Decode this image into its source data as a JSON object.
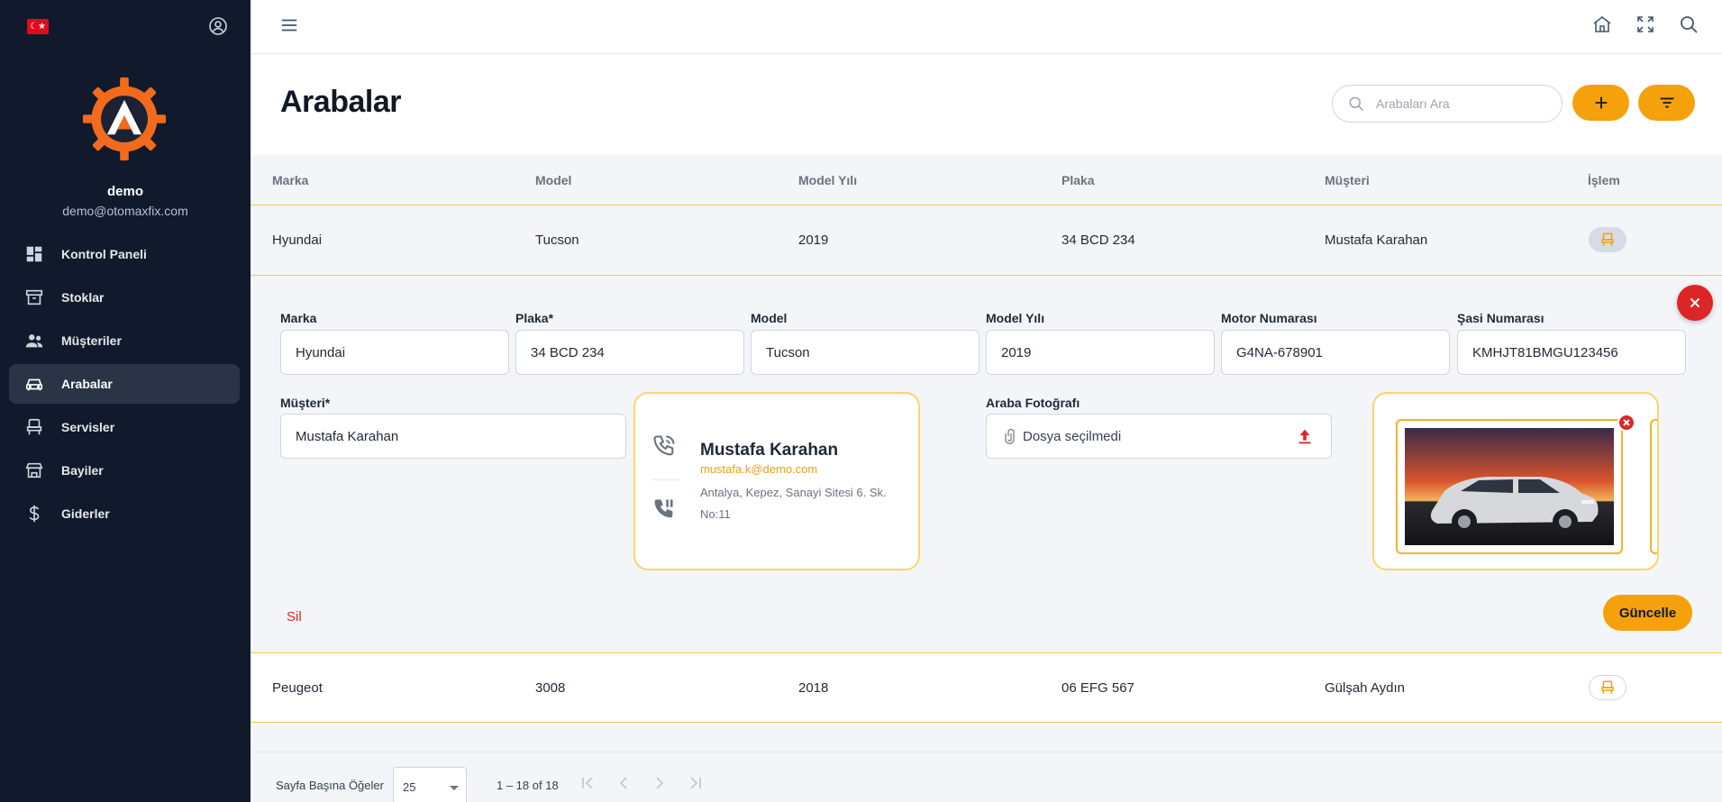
{
  "sidebar": {
    "flag_symbol": "☾★",
    "user": {
      "name": "demo",
      "email": "demo@otomaxfix.com"
    },
    "items": [
      {
        "label": "Kontrol Paneli",
        "icon": "dashboard-icon",
        "active": false
      },
      {
        "label": "Stoklar",
        "icon": "archive-icon",
        "active": false
      },
      {
        "label": "Müşteriler",
        "icon": "people-icon",
        "active": false
      },
      {
        "label": "Arabalar",
        "icon": "car-icon",
        "active": true
      },
      {
        "label": "Servisler",
        "icon": "seat-icon",
        "active": false
      },
      {
        "label": "Bayiler",
        "icon": "store-icon",
        "active": false
      },
      {
        "label": "Giderler",
        "icon": "dollar-icon",
        "active": false
      }
    ]
  },
  "page": {
    "title": "Arabalar",
    "search_placeholder": "Arabaları Ara"
  },
  "table": {
    "columns": [
      "Marka",
      "Model",
      "Model Yılı",
      "Plaka",
      "Müşteri",
      "İşlem"
    ],
    "rows": [
      {
        "marka": "Hyundai",
        "model": "Tucson",
        "yil": "2019",
        "plaka": "34 BCD 234",
        "musteri": "Mustafa Karahan"
      },
      {
        "marka": "Peugeot",
        "model": "3008",
        "yil": "2018",
        "plaka": "06 EFG 567",
        "musteri": "Gülşah Aydın"
      }
    ]
  },
  "detail": {
    "labels": {
      "marka": "Marka",
      "plaka": "Plaka*",
      "model": "Model",
      "yil": "Model Yılı",
      "motor": "Motor Numarası",
      "sasi": "Şasi Numarası",
      "musteri": "Müşteri*",
      "foto": "Araba Fotoğrafı"
    },
    "values": {
      "marka": "Hyundai",
      "plaka": "34 BCD 234",
      "model": "Tucson",
      "yil": "2019",
      "motor": "G4NA-678901",
      "sasi": "KMHJT81BMGU123456",
      "musteri": "Mustafa Karahan"
    },
    "customer_card": {
      "name": "Mustafa Karahan",
      "email": "mustafa.k@demo.com",
      "address": "Antalya, Kepez, Sanayi Sitesi 6. Sk. No:11"
    },
    "file_status": "Dosya seçilmedi",
    "delete_label": "Sil",
    "update_label": "Güncelle"
  },
  "paginator": {
    "items_per_page_label": "Sayfa Başına Öğeler",
    "page_size": "25",
    "range": "1 – 18 of 18"
  },
  "colors": {
    "sidebar_bg": "#111a2c",
    "accent": "#f5a10c",
    "danger": "#dc2626"
  }
}
